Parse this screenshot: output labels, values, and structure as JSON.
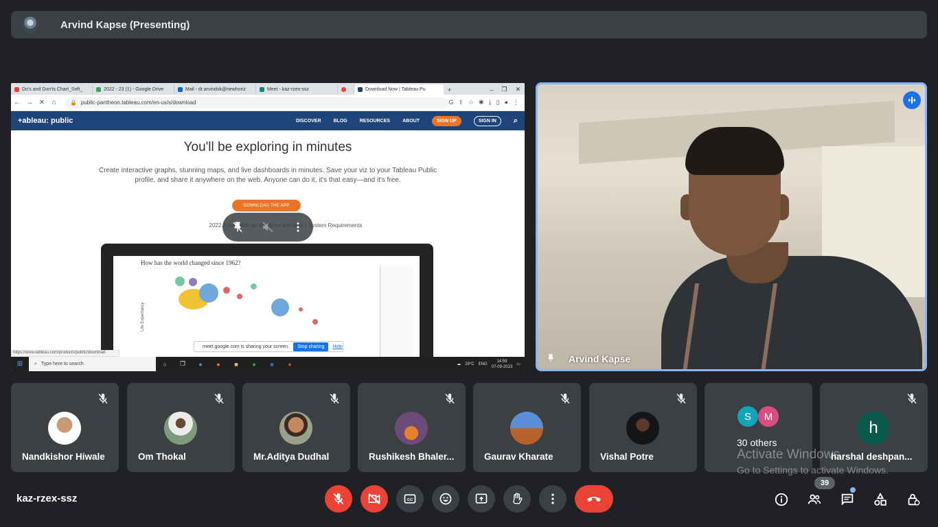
{
  "presenting": {
    "label": "Arvind Kapse (Presenting)"
  },
  "shared_screen": {
    "tabs": [
      {
        "label": "Do's and Don'ts Chart_Soft_",
        "color": "#ea4335"
      },
      {
        "label": "2022 - 23 (1) - Google Drive",
        "color": "#34a853"
      },
      {
        "label": "Mail - dr.arvindsk@newhoriz",
        "color": "#0a66c2"
      },
      {
        "label": "Meet - kaz-rzex-ssz",
        "color": "#00897b"
      },
      {
        "label": "",
        "color": "#ea4335"
      },
      {
        "label": "Download Now | Tableau Pu",
        "color": "#1f447a"
      }
    ],
    "url": "public-pantheon.tableau.com/en-us/s/download",
    "site_logo": "+ableau: public",
    "nav": [
      "DISCOVER",
      "BLOG",
      "RESOURCES",
      "ABOUT"
    ],
    "signup": "SIGN UP",
    "signin": "SIGN IN",
    "headline": "You'll be exploring in minutes",
    "body_text": "Create interactive graphs, stunning maps, and live dashboards in minutes. Save your viz to your Tableau Public profile, and share it anywhere on the web. Anyone can do it, it's that easy—and it's free.",
    "download_button": "DOWNLOAD THE APP",
    "availability": "2022.2 Available for Windows and Mac  |  System Requirements",
    "chart_question": "How has the world changed since 1962?",
    "y_axis": "Life Expectancy",
    "share_notice": "meet.google.com is sharing your screen.",
    "stop_sharing": "Stop sharing",
    "hide": "Hide",
    "status_url": "https://www.tableau.com/products/public/download",
    "taskbar_search": "Type here to search",
    "weather": "29°C",
    "lang": "ENG",
    "time": "14:59",
    "date": "07-09-2023"
  },
  "video": {
    "name": "Arvind Kapse"
  },
  "participants": [
    {
      "name": "Nandkishor Hiwale",
      "avatar_color": "#8a6a55"
    },
    {
      "name": "Om Thokal",
      "avatar_color": "#9aa390"
    },
    {
      "name": "Mr.Aditya Dudhal",
      "avatar_color": "#a87a55"
    },
    {
      "name": "Rushikesh Bhaler...",
      "avatar_color": "#6c4a7a"
    },
    {
      "name": "Gaurav Kharate",
      "avatar_color": "#5b8fd6"
    },
    {
      "name": "Vishal Potre",
      "avatar_color": "#151515"
    }
  ],
  "others": {
    "label": "30 others",
    "initials": [
      "S",
      "M"
    ],
    "colors": [
      "#12a4b8",
      "#d94f84"
    ]
  },
  "last_participant": {
    "name": "harshal deshpan...",
    "initial": "h",
    "color": "#0b5a4e"
  },
  "watermark": {
    "line1": "Activate Windows",
    "line2": "Go to Settings to activate Windows."
  },
  "meeting_code": "kaz-rzex-ssz",
  "people_count": "39",
  "colors": {
    "accent": "#8ab4f8",
    "danger": "#ea4335",
    "tile": "#3c4043",
    "bg": "#202124"
  }
}
